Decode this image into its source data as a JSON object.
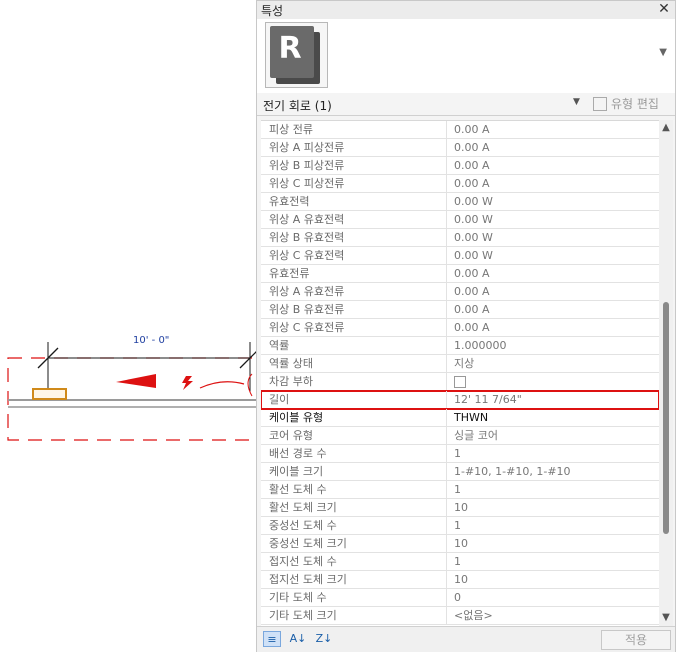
{
  "drawing": {
    "dimension_label": "10' - 0\""
  },
  "panel": {
    "title": "특성",
    "type_icon_letter": "R",
    "selector_label": "전기 회로 (1)",
    "edit_type_label": "유형 편집",
    "apply_label": "적용",
    "properties": [
      {
        "label": "피상 전류",
        "value": "0.00 A"
      },
      {
        "label": "위상 A 피상전류",
        "value": "0.00 A"
      },
      {
        "label": "위상 B 피상전류",
        "value": "0.00 A"
      },
      {
        "label": "위상 C 피상전류",
        "value": "0.00 A"
      },
      {
        "label": "유효전력",
        "value": "0.00 W"
      },
      {
        "label": "위상 A 유효전력",
        "value": "0.00 W"
      },
      {
        "label": "위상 B 유효전력",
        "value": "0.00 W"
      },
      {
        "label": "위상 C 유효전력",
        "value": "0.00 W"
      },
      {
        "label": "유효전류",
        "value": "0.00 A"
      },
      {
        "label": "위상 A 유효전류",
        "value": "0.00 A"
      },
      {
        "label": "위상 B 유효전류",
        "value": "0.00 A"
      },
      {
        "label": "위상 C 유효전류",
        "value": "0.00 A"
      },
      {
        "label": "역률",
        "value": "1.000000"
      },
      {
        "label": "역률 상태",
        "value": "지상"
      },
      {
        "label": "차감 부하",
        "value": ""
      },
      {
        "label": "길이",
        "value": "12'  11 7/64\""
      },
      {
        "label": "케이블 유형",
        "value": "THWN"
      },
      {
        "label": "코어 유형",
        "value": "싱글 코어"
      },
      {
        "label": "배선 경로 수",
        "value": "1"
      },
      {
        "label": "케이블 크기",
        "value": "1-#10, 1-#10, 1-#10"
      },
      {
        "label": "활선 도체 수",
        "value": "1"
      },
      {
        "label": "활선 도체 크기",
        "value": "10"
      },
      {
        "label": "중성선 도체 수",
        "value": "1"
      },
      {
        "label": "중성선 도체 크기",
        "value": "10"
      },
      {
        "label": "접지선 도체 수",
        "value": "1"
      },
      {
        "label": "접지선 도체 크기",
        "value": "10"
      },
      {
        "label": "기타 도체 수",
        "value": "0"
      },
      {
        "label": "기타 도체 크기",
        "value": "<없음>"
      }
    ],
    "scroll_position": 0.45
  },
  "colors": {
    "selection_highlight": "#dd1111",
    "wire_red": "#dd1111",
    "fixture_orange": "#d08a1a",
    "dimension_blue": "#1f3fa0"
  }
}
